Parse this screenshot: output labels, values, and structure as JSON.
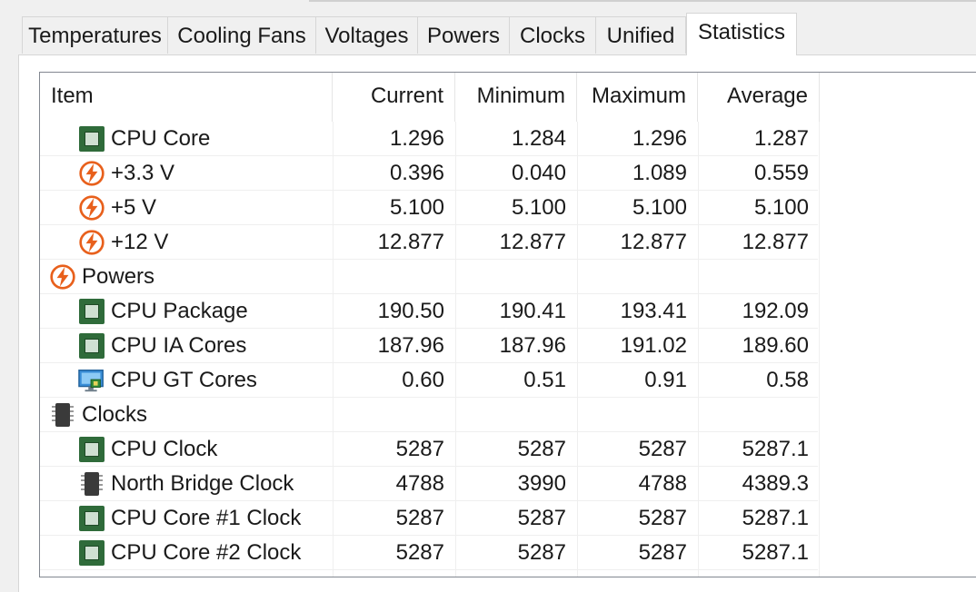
{
  "tabs": [
    {
      "label": "Temperatures"
    },
    {
      "label": "Cooling Fans"
    },
    {
      "label": "Voltages"
    },
    {
      "label": "Powers"
    },
    {
      "label": "Clocks"
    },
    {
      "label": "Unified"
    },
    {
      "label": "Statistics",
      "active": true
    }
  ],
  "columns": {
    "item": "Item",
    "current": "Current",
    "minimum": "Minimum",
    "maximum": "Maximum",
    "average": "Average"
  },
  "rows": [
    {
      "name": "CPU Core",
      "icon": "cpu-chip-icon",
      "indent": true,
      "current": "1.296",
      "minimum": "1.284",
      "maximum": "1.296",
      "average": "1.287"
    },
    {
      "name": "+3.3 V",
      "icon": "voltage-bolt-icon",
      "indent": true,
      "current": "0.396",
      "minimum": "0.040",
      "maximum": "1.089",
      "average": "0.559"
    },
    {
      "name": "+5 V",
      "icon": "voltage-bolt-icon",
      "indent": true,
      "current": "5.100",
      "minimum": "5.100",
      "maximum": "5.100",
      "average": "5.100"
    },
    {
      "name": "+12 V",
      "icon": "voltage-bolt-icon",
      "indent": true,
      "current": "12.877",
      "minimum": "12.877",
      "maximum": "12.877",
      "average": "12.877"
    },
    {
      "name": "Powers",
      "icon": "power-bolt-icon",
      "indent": false,
      "current": "",
      "minimum": "",
      "maximum": "",
      "average": ""
    },
    {
      "name": "CPU Package",
      "icon": "cpu-chip-icon",
      "indent": true,
      "current": "190.50",
      "minimum": "190.41",
      "maximum": "193.41",
      "average": "192.09"
    },
    {
      "name": "CPU IA Cores",
      "icon": "cpu-chip-icon",
      "indent": true,
      "current": "187.96",
      "minimum": "187.96",
      "maximum": "191.02",
      "average": "189.60"
    },
    {
      "name": "CPU GT Cores",
      "icon": "gpu-monitor-icon",
      "indent": true,
      "current": "0.60",
      "minimum": "0.51",
      "maximum": "0.91",
      "average": "0.58"
    },
    {
      "name": "Clocks",
      "icon": "memory-chip-icon",
      "indent": false,
      "current": "",
      "minimum": "",
      "maximum": "",
      "average": ""
    },
    {
      "name": "CPU Clock",
      "icon": "cpu-chip-icon",
      "indent": true,
      "current": "5287",
      "minimum": "5287",
      "maximum": "5287",
      "average": "5287.1"
    },
    {
      "name": "North Bridge Clock",
      "icon": "memory-chip-icon",
      "indent": true,
      "current": "4788",
      "minimum": "3990",
      "maximum": "4788",
      "average": "4389.3"
    },
    {
      "name": "CPU Core #1 Clock",
      "icon": "cpu-chip-icon",
      "indent": true,
      "current": "5287",
      "minimum": "5287",
      "maximum": "5287",
      "average": "5287.1"
    },
    {
      "name": "CPU Core #2 Clock",
      "icon": "cpu-chip-icon",
      "indent": true,
      "current": "5287",
      "minimum": "5287",
      "maximum": "5287",
      "average": "5287.1"
    }
  ],
  "colors": {
    "bolt": "#e8601c",
    "chip": "#2f6b3a"
  }
}
